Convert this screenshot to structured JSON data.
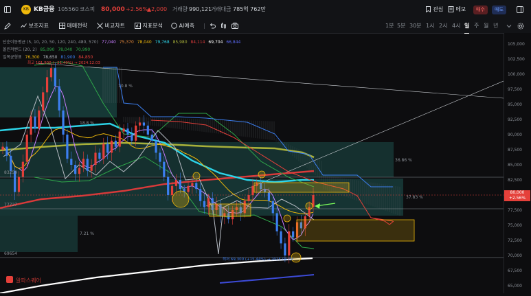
{
  "header": {
    "logo_text": "KB",
    "name": "KB금융",
    "code": "105560",
    "market": "코스피",
    "price": "80,000",
    "change_pct": "+2.56%",
    "change_amt": "▲2,000",
    "volume_label": "거래량",
    "volume": "990,121",
    "turnover_label": "거래대금",
    "turnover": "785억 762만",
    "watch_label": "관심",
    "memo_label": "메모",
    "buy_label": "매수",
    "sell_label": "매도"
  },
  "toolbar": {
    "indicators_label": "보조지표",
    "strategy_label": "매매전략",
    "compare_label": "비교차트",
    "analysis_label": "지표분석",
    "ai_label": "AI예측",
    "intervals": [
      "1분",
      "5분",
      "30분",
      "1시",
      "2시",
      "4시",
      "일",
      "주",
      "월",
      "년"
    ],
    "active_interval": "일"
  },
  "legend": {
    "ma_label": "단순이동평균 (5, 10, 20, 50, 120, 240, 480, 570)",
    "ma_values": [
      "77,040",
      "75,370",
      "78,040",
      "79,768",
      "85,980",
      "84,114",
      "69,704",
      "66,844"
    ],
    "bb_label": "볼린저밴드 (20, 2)",
    "bb_values": [
      "85,090",
      "78,040",
      "70,990"
    ],
    "ichi_label": "일목균형표",
    "ichi_values": [
      "76,300",
      "78,650",
      "81,900",
      "84,850"
    ],
    "high_note": "최고 101,900 (−21.49%) → 2024.12.03"
  },
  "annotations": {
    "pct_108": "10.8 %",
    "pct_188": "18.8 %",
    "pct_3686": "36.86 %",
    "pct_3783": "37.83 %",
    "pct_721": "7.21 %",
    "lvl_83259": "83259",
    "lvl_77727": "77727",
    "lvl_69654": "69654",
    "low_note": "최저 69,300 (+15.44%) → 2025.04.09",
    "watermark": "알파스퀘어"
  },
  "price_tag": {
    "price": "80,000",
    "pct": "+2.56%"
  },
  "colors": {
    "up": "#e5403a",
    "down": "#3c7ff0",
    "accent": "#f0b90b",
    "teal_box": "#1f5c57",
    "bg": "#0d0d0f"
  },
  "chart_data": {
    "type": "candlestick",
    "title": "KB금융 105560 일봉",
    "ylim": [
      64000,
      106500
    ],
    "y_ticks": [
      65000,
      67500,
      70000,
      72500,
      75000,
      77500,
      80000,
      82500,
      85000,
      87500,
      90000,
      92500,
      95000,
      97500,
      100000,
      102500,
      105000
    ],
    "last_close": 80000,
    "closes": [
      88000,
      86500,
      84000,
      80500,
      83000,
      85500,
      90000,
      93000,
      91000,
      94000,
      97000,
      99500,
      101000,
      98000,
      94000,
      90000,
      86000,
      85000,
      83500,
      84500,
      86000,
      84000,
      85000,
      87000,
      86000,
      88500,
      87000,
      89000,
      88000,
      90500,
      91000,
      90000,
      89000,
      91500,
      92000,
      91500,
      90000,
      89000,
      87000,
      85500,
      83000,
      80000,
      81500,
      82500,
      81000,
      80500,
      81500,
      82000,
      81000,
      79000,
      78000,
      79500,
      77500,
      78500,
      76500,
      77000,
      76000,
      77500,
      78000,
      77000,
      79000,
      80000,
      81500,
      82000,
      81000,
      80500,
      79000,
      77000,
      74000,
      72000,
      70000,
      74000,
      73000,
      75500,
      74500,
      76500,
      78000,
      80000
    ],
    "levels": [
      83259,
      77727,
      69654
    ]
  }
}
